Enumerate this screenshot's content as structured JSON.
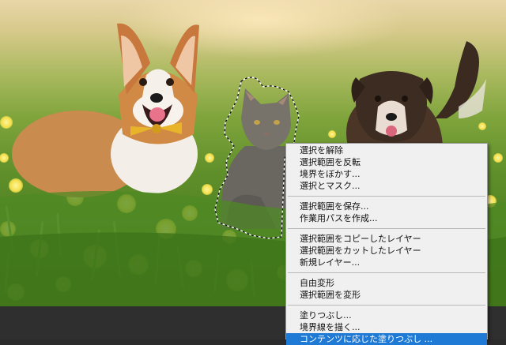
{
  "context_menu": {
    "groups": [
      [
        "選択を解除",
        "選択範囲を反転",
        "境界をぼかす...",
        "選択とマスク..."
      ],
      [
        "選択範囲を保存...",
        "作業用パスを作成..."
      ],
      [
        "選択範囲をコピーしたレイヤー",
        "選択範囲をカットしたレイヤー",
        "新規レイヤー..."
      ],
      [
        "自由変形",
        "選択範囲を変形"
      ],
      [
        "塗りつぶし...",
        "境界線を描く...",
        "コンテンツに応じた塗りつぶし ..."
      ]
    ],
    "highlighted_item": "コンテンツに応じた塗りつぶし ...",
    "colors": {
      "background": "#f0f0f0",
      "highlight": "#1f7ad6",
      "separator": "#b9b9b9"
    }
  },
  "canvas": {
    "subjects": [
      "corgi-dog",
      "tabby-cat",
      "brown-dog"
    ],
    "selection": "cat-marquee"
  }
}
